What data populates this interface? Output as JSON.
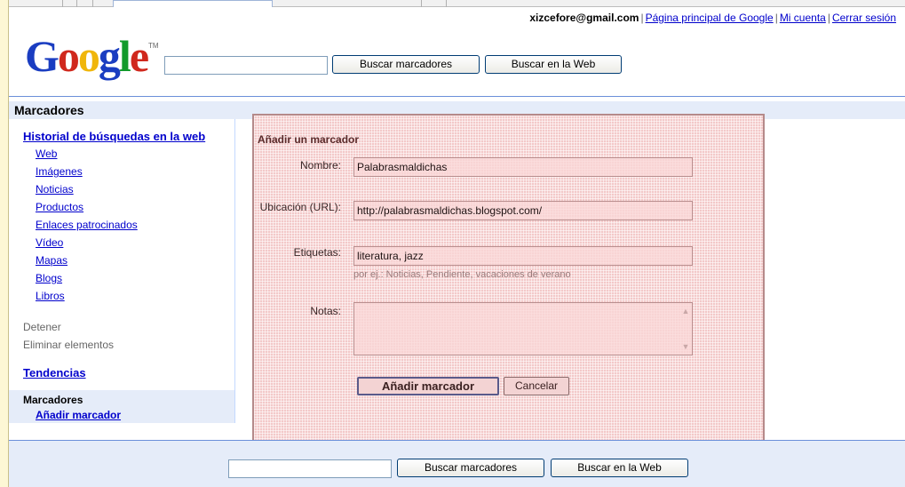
{
  "account": {
    "email": "xizcefore@gmail.com",
    "home_link": "Página principal de Google",
    "account_link": "Mi cuenta",
    "logout_link": "Cerrar sesión"
  },
  "logo": {
    "letters": [
      "G",
      "o",
      "o",
      "g",
      "l",
      "e"
    ],
    "colors": [
      "#1a3dc1",
      "#d0281d",
      "#f0b60b",
      "#1a3dc1",
      "#119a2b",
      "#d0281d"
    ],
    "tm": "TM"
  },
  "search": {
    "value": "",
    "bookmarks_button": "Buscar marcadores",
    "web_button": "Buscar en la Web"
  },
  "page_title": "Marcadores",
  "sidebar": {
    "history_heading": "Historial de búsquedas en la web",
    "history_items": [
      "Web",
      "Imágenes",
      "Noticias",
      "Productos",
      "Enlaces patrocinados",
      "Vídeo",
      "Mapas",
      "Blogs",
      "Libros"
    ],
    "stop": "Detener",
    "delete_items": "Eliminar elementos",
    "trends": "Tendencias",
    "bookmarks_label": "Marcadores",
    "add_bookmark": "Añadir marcador"
  },
  "dialog": {
    "title": "Añadir un marcador",
    "name_label": "Nombre:",
    "name_value": "Palabrasmaldichas",
    "url_label": "Ubicación (URL):",
    "url_value": "http://palabrasmaldichas.blogspot.com/",
    "tags_label": "Etiquetas:",
    "tags_value": "literatura, jazz",
    "tags_hint": "por ej.: Noticias, Pendiente, vacaciones de verano",
    "notes_label": "Notas:",
    "notes_value": "",
    "submit_button": "Añadir marcador",
    "cancel_button": "Cancelar"
  },
  "footer_search": {
    "value": "",
    "bookmarks_button": "Buscar marcadores",
    "web_button": "Buscar en la Web"
  }
}
